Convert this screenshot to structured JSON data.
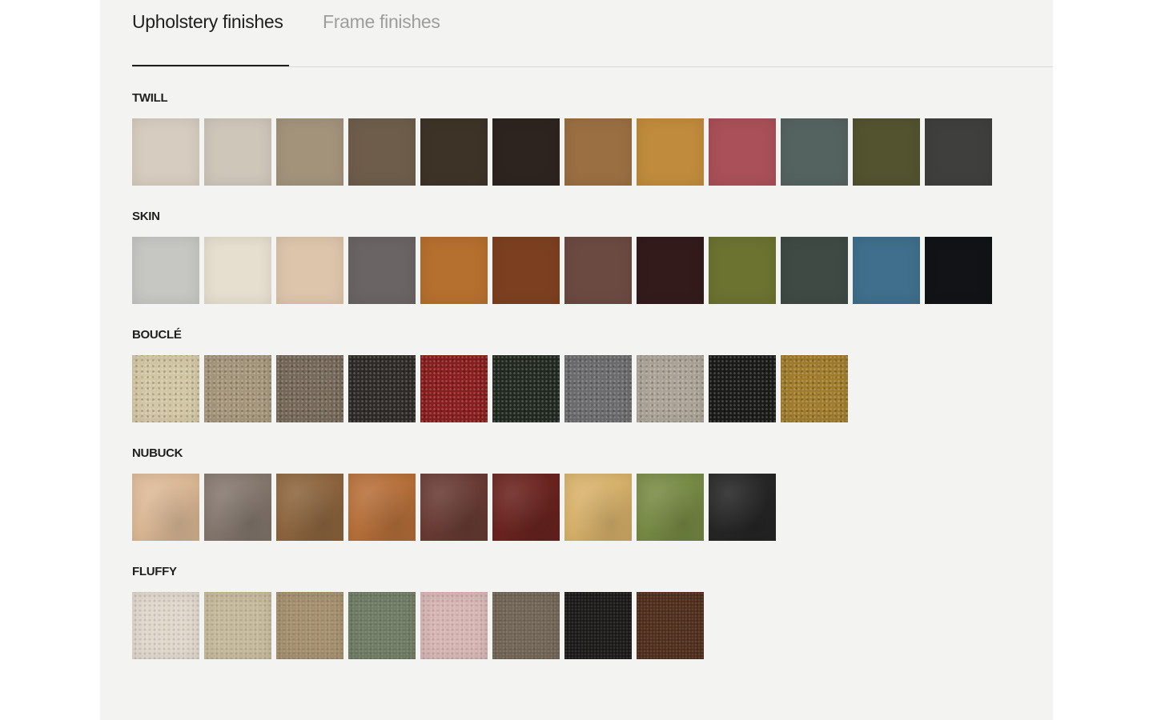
{
  "tabs": {
    "active": "Upholstery finishes",
    "inactive": "Frame finishes"
  },
  "sections": [
    {
      "title": "TWILL",
      "style": "plain",
      "swatches": [
        "#d6ccbf",
        "#cfc6ba",
        "#a3937b",
        "#6e5d4b",
        "#3e3327",
        "#2d241f",
        "#9a6f42",
        "#c08b3c",
        "#a95058",
        "#556360",
        "#535330",
        "#3f3f3e"
      ]
    },
    {
      "title": "SKIN",
      "style": "plain",
      "swatches": [
        "#c6c6c3",
        "#e6dfd0",
        "#dcc5ab",
        "#6a6464",
        "#b56f2f",
        "#7c4020",
        "#6b4a42",
        "#331b1c",
        "#6c7230",
        "#3f4a45",
        "#3f6f8c",
        "#121316"
      ]
    },
    {
      "title": "BOUCLÉ",
      "style": "texture",
      "swatches": [
        "#d3c6a4",
        "#a5967b",
        "#76695a",
        "#2f2b28",
        "#8a1e1e",
        "#232a22",
        "#6c6b6d",
        "#aba397",
        "#1b1b1a",
        "#a07c2c"
      ]
    },
    {
      "title": "NUBUCK",
      "style": "suede",
      "swatches": [
        "#dcb996",
        "#85786f",
        "#8e663f",
        "#b7703a",
        "#6a3c35",
        "#6b2420",
        "#d8b26b",
        "#788b45",
        "#262626"
      ]
    },
    {
      "title": "FLUFFY",
      "style": "fluffy",
      "swatches": [
        "#e0d7cc",
        "#c5b99a",
        "#a48e6c",
        "#6d7a61",
        "#d7b5b4",
        "#6f6353",
        "#181515",
        "#4e2a18"
      ]
    }
  ]
}
